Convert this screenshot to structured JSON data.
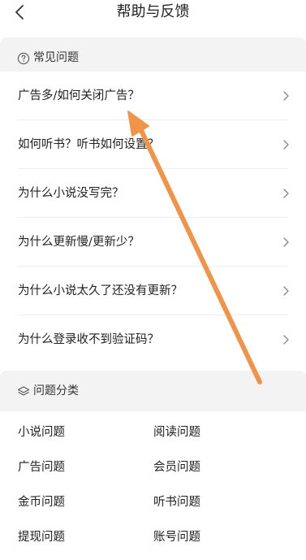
{
  "header": {
    "title": "帮助与反馈"
  },
  "faq_section": {
    "title": "常见问题",
    "icon": "question-circle-icon",
    "items": [
      {
        "label": "广告多/如何关闭广告？"
      },
      {
        "label": "如何听书？听书如何设置？"
      },
      {
        "label": "为什么小说没写完？"
      },
      {
        "label": "为什么更新慢/更新少？"
      },
      {
        "label": "为什么小说太久了还没有更新？"
      },
      {
        "label": "为什么登录收不到验证码？"
      }
    ]
  },
  "category_section": {
    "title": "问题分类",
    "icon": "layers-icon",
    "items": [
      {
        "label": "小说问题"
      },
      {
        "label": "阅读问题"
      },
      {
        "label": "广告问题"
      },
      {
        "label": "会员问题"
      },
      {
        "label": "金币问题"
      },
      {
        "label": "听书问题"
      },
      {
        "label": "提现问题"
      },
      {
        "label": "账号问题"
      }
    ]
  },
  "colors": {
    "annotation_arrow": "#f0944a",
    "section_background": "#f3f3f3"
  }
}
